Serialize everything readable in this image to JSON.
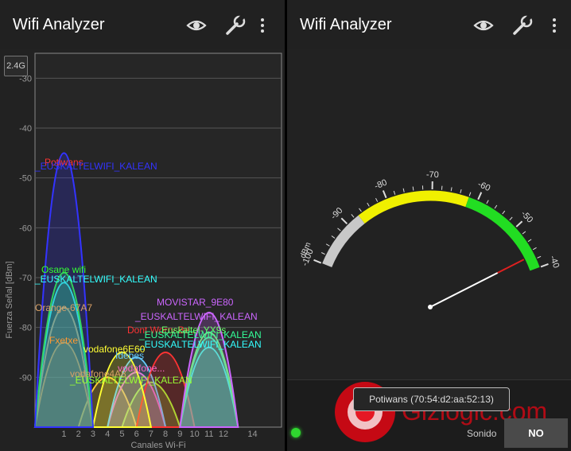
{
  "left_panel": {
    "title": "Wifi Analyzer",
    "band": "2.4G",
    "y_axis_label": "Fuerza Señal [dBm]",
    "x_axis_label": "Canales Wi-Fi",
    "y_ticks": [
      "-30",
      "-40",
      "-50",
      "-60",
      "-70",
      "-80",
      "-90"
    ],
    "x_ticks": [
      "1",
      "2",
      "3",
      "4",
      "5",
      "6",
      "7",
      "8",
      "9",
      "10",
      "11",
      "12",
      "14"
    ],
    "network_labels": [
      "Potiwans",
      "_EUSKALTELWIFI_KALEAN",
      "Osane wifi",
      "_EUSKALTELWIFI_KALEAN",
      "Orange-67A7",
      "MOVISTAR_9E80",
      "_EUSKALTELWIFI_KALEAN",
      "Dont Worry Be ...",
      "Euskaltel-YX9s",
      "_EUSKALTELWIFI_KALEAN",
      "_EUSKALTELWIFI_KALEAN",
      "Fxetxe",
      "vodafone6E60",
      "Idebes",
      "vodafone4A8",
      "vodafone...",
      "_EUSKALTELWIFI_KALEAN"
    ]
  },
  "right_panel": {
    "title": "Wifi Analyzer",
    "gauge_unit": "dBm",
    "gauge_ticks": [
      "-100",
      "-90",
      "-80",
      "-70",
      "-60",
      "-50",
      "-40"
    ],
    "selected_network": "Potiwans (70:54:d2:aa:52:13)",
    "sound_label": "Sonido",
    "sound_button": "NO",
    "watermark": "Gizlogic.com"
  },
  "chart_data": {
    "type": "area",
    "xlabel": "Canales Wi-Fi",
    "ylabel": "Fuerza Señal [dBm]",
    "ylim": [
      -100,
      -25
    ],
    "xlim": [
      -1,
      16
    ],
    "grid": true,
    "series": [
      {
        "name": "Potiwans",
        "channel": 1,
        "signal": -45,
        "color": "#3333ff"
      },
      {
        "name": "Osane wifi",
        "channel": 1,
        "signal": -69,
        "color": "#33ff33"
      },
      {
        "name": "_EUSKALTELWIFI_KALEAN",
        "channel": 1,
        "signal": -71,
        "color": "#33ffff"
      },
      {
        "name": "Orange-67A7",
        "channel": 1,
        "signal": -76,
        "color": "#d9a066"
      },
      {
        "name": "Fxetxe",
        "channel": 1,
        "signal": -83,
        "color": "#ff9933"
      },
      {
        "name": "MOVISTAR_9E80",
        "channel": 11,
        "signal": -77,
        "color": "#cc66ff"
      },
      {
        "name": "Euskaltel-YX9s",
        "channel": 11,
        "signal": -81,
        "color": "#66ff66"
      },
      {
        "name": "_EUSKALTELWIFI_KALEAN",
        "channel": 11,
        "signal": -82,
        "color": "#33ff99"
      },
      {
        "name": "_EUSKALTELWIFI_KALEAN",
        "channel": 11,
        "signal": -84,
        "color": "#33ffff"
      },
      {
        "name": "Dont Worry Be ...",
        "channel": 8,
        "signal": -85,
        "color": "#ff3333"
      },
      {
        "name": "vodafone6E60",
        "channel": 5,
        "signal": -85,
        "color": "#ffff33"
      },
      {
        "name": "Idebes",
        "channel": 6,
        "signal": -86,
        "color": "#66ccff"
      },
      {
        "name": "vodafone4A8",
        "channel": 6,
        "signal": -89,
        "color": "#ff66cc"
      },
      {
        "name": "_EUSKALTELWIFI_KALEAN",
        "channel": 7,
        "signal": -91,
        "color": "#99ff33"
      },
      {
        "name": "vodafone...",
        "channel": 4,
        "signal": -90,
        "color": "#ffcc33"
      }
    ]
  },
  "gauge_data": {
    "min": -100,
    "max": -40,
    "value": -43,
    "zones": [
      {
        "from": -100,
        "to": -87,
        "color": "#c8c8c8"
      },
      {
        "from": -87,
        "to": -62,
        "color": "#f0f000"
      },
      {
        "from": -62,
        "to": -40,
        "color": "#22dd22"
      }
    ]
  }
}
